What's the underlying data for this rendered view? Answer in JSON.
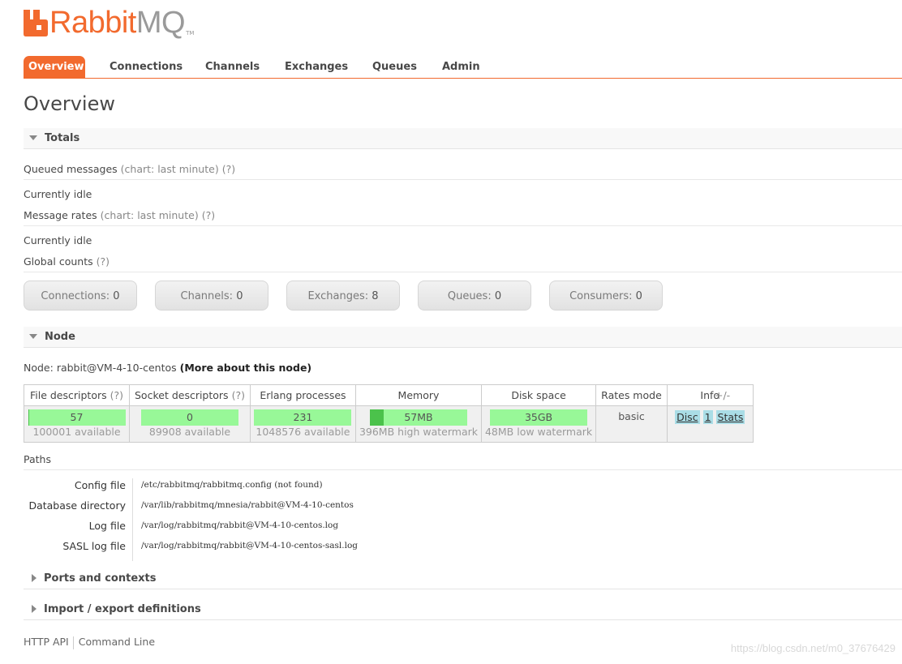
{
  "brand": {
    "name_a": "Rabbit",
    "name_b": "MQ",
    "tm": "TM",
    "accent": "#f26a2e"
  },
  "nav": {
    "tabs": [
      {
        "label": "Overview",
        "active": true
      },
      {
        "label": "Connections"
      },
      {
        "label": "Channels"
      },
      {
        "label": "Exchanges"
      },
      {
        "label": "Queues"
      },
      {
        "label": "Admin"
      }
    ]
  },
  "page_title": "Overview",
  "totals": {
    "heading": "Totals",
    "queued": {
      "label": "Queued messages",
      "chart": "(chart: last minute)",
      "help": "(?)",
      "status": "Currently idle"
    },
    "rates": {
      "label": "Message rates",
      "chart": "(chart: last minute)",
      "help": "(?)",
      "status": "Currently idle"
    },
    "global": {
      "label": "Global counts",
      "help": "(?)"
    },
    "counts": [
      {
        "label": "Connections:",
        "value": "0"
      },
      {
        "label": "Channels:",
        "value": "0"
      },
      {
        "label": "Exchanges:",
        "value": "8"
      },
      {
        "label": "Queues:",
        "value": "0"
      },
      {
        "label": "Consumers:",
        "value": "0"
      }
    ]
  },
  "node": {
    "heading": "Node",
    "prefix": "Node:",
    "name": "rabbit@VM-4-10-centos",
    "more_link": "(More about this node)",
    "columns": [
      "File descriptors",
      "Socket descriptors",
      "Erlang processes",
      "Memory",
      "Disk space",
      "Rates mode",
      "Info"
    ],
    "help": "(?)",
    "file_desc": {
      "value": "57",
      "sub": "100001 available",
      "fill": 0.001
    },
    "socket_desc": {
      "value": "0",
      "sub": "89908 available",
      "fill": 0
    },
    "erlang": {
      "value": "231",
      "sub": "1048576 available",
      "fill": 0.0002
    },
    "memory": {
      "value": "57MB",
      "sub": "396MB high watermark",
      "fill": 0.144
    },
    "disk": {
      "value": "35GB",
      "sub": "48MB low watermark",
      "fill": 0
    },
    "rates_mode": "basic",
    "info": [
      "Disc",
      "1",
      "Stats"
    ],
    "plus_minus": "+/-"
  },
  "paths": {
    "heading": "Paths",
    "rows": [
      {
        "label": "Config file",
        "value": "/etc/rabbitmq/rabbitmq.config (not found)"
      },
      {
        "label": "Database directory",
        "value": "/var/lib/rabbitmq/mnesia/rabbit@VM-4-10-centos"
      },
      {
        "label": "Log file",
        "value": "/var/log/rabbitmq/rabbit@VM-4-10-centos.log"
      },
      {
        "label": "SASL log file",
        "value": "/var/log/rabbitmq/rabbit@VM-4-10-centos-sasl.log"
      }
    ]
  },
  "collapsed_sections": [
    "Ports and contexts",
    "Import / export definitions"
  ],
  "footer": {
    "http_api": "HTTP API",
    "command_line": "Command Line"
  },
  "watermark": "https://blog.csdn.net/m0_37676429"
}
